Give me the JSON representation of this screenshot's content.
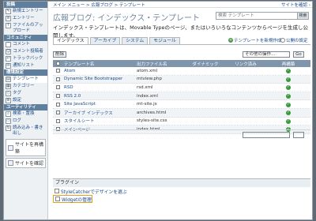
{
  "sidebar": {
    "sections": [
      {
        "title": "投稿",
        "items": [
          "新規エントリー",
          "エントリー",
          "ファイルのアップロード"
        ]
      },
      {
        "title": "コミュニティ",
        "items": [
          "コメント",
          "コメント投稿者",
          "トラックバック",
          "通知リスト"
        ]
      },
      {
        "title": "環境設定",
        "items": [
          "テンプレート",
          "カテゴリー",
          "タグ",
          "設定"
        ]
      },
      {
        "title": "ユーティリティ",
        "items": [
          "検索・置換",
          "ログ",
          "読み込み・書き出し",
          "サイトを再構築",
          "サイトを確認"
        ]
      }
    ]
  },
  "topbar": {
    "breadcrumb": "メイン メニュー > 広報ブログ > テンプレート",
    "site_confirm": "サイトを確認 ›"
  },
  "page": {
    "title": "広報ブログ: インデックス・テンプレート",
    "description": "インデックス・テンプレートは、Movable Typeのページ、またはいろいろなコンテンツからページを生成し公開します。",
    "search_placeholder": "検索 テンプレート",
    "search_button": "検索"
  },
  "tabs": [
    "インデックス",
    "アーカイブ",
    "システム",
    "モジュール"
  ],
  "links": {
    "new_template": "テンプレートを新規作成",
    "settings": "公開の設定"
  },
  "actions": {
    "delete": "削除",
    "select_placeholder": "その他の操作...",
    "go": "Go"
  },
  "table": {
    "headers": [
      "テンプレート名",
      "出力ファイル名",
      "ダイナミック",
      "リンク済み",
      "再構築"
    ],
    "rows": [
      {
        "name": "Atom",
        "file": "atom.xml"
      },
      {
        "name": "Dynamic Site Bootstrapper",
        "file": "mtview.php"
      },
      {
        "name": "RSD",
        "file": "rsd.xml"
      },
      {
        "name": "RSS 2.0",
        "file": "index.xml"
      },
      {
        "name": "Site JavaScript",
        "file": "mt-site.js"
      },
      {
        "name": "アーカイブ インデックス",
        "file": "archives.html"
      },
      {
        "name": "スタイルシート",
        "file": "styles-site.css"
      },
      {
        "name": "メインページ",
        "file": "index.html"
      }
    ]
  },
  "plugins": {
    "header": "プラグイン",
    "links": [
      "StyleCatcherでデザインを選ぶ",
      "Widgetの管理"
    ]
  }
}
